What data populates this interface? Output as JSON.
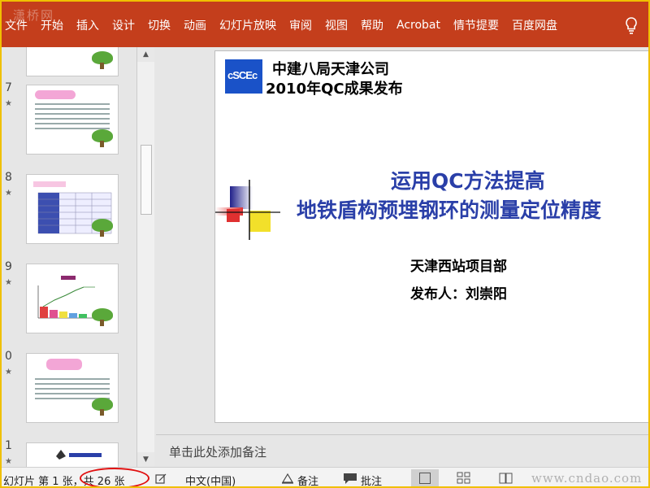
{
  "watermark_top": "潇桥网",
  "ribbon": {
    "tabs": [
      "文件",
      "开始",
      "插入",
      "设计",
      "切换",
      "动画",
      "幻灯片放映",
      "审阅",
      "视图",
      "帮助",
      "Acrobat",
      "情节提要",
      "百度网盘"
    ]
  },
  "thumbnails": [
    {
      "number": "7",
      "pill": "四、确认原因"
    },
    {
      "number": "8",
      "header": "效果统计表："
    },
    {
      "number": "9"
    },
    {
      "number": "0",
      "pill": "五、方案实施"
    },
    {
      "number": "1"
    }
  ],
  "slide": {
    "company": "中建八局天津公司",
    "subtitle": "2010年QC成果发布",
    "title_line1": "运用QC方法提高",
    "title_line2": "地铁盾构预埋钢环的测量定位精度",
    "department": "天津西站项目部",
    "presenter": "发布人：刘崇阳",
    "logo_text": "cSCEc"
  },
  "notes": {
    "placeholder": "单击此处添加备注"
  },
  "status": {
    "slide_info": "幻灯片 第 1 张，共 26 张",
    "language": "中文(中国)",
    "notes_button": "备注",
    "comments_button": "批注"
  },
  "watermark_bottom": "www.cndao.com",
  "colors": {
    "ribbon": "#c43e1c",
    "title_blue": "#2a3fa8",
    "logo_blue": "#1a52c8",
    "highlight_circle": "#e01010"
  }
}
